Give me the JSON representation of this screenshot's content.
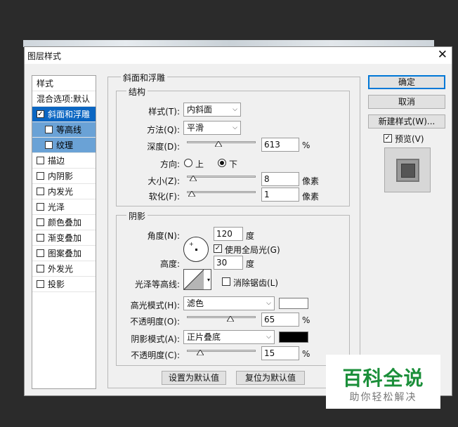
{
  "dialog": {
    "title": "图层样式",
    "close_icon": "close-icon"
  },
  "left_list": {
    "items": [
      {
        "label": "样式",
        "checkbox": false,
        "checked": false
      },
      {
        "label": "混合选项:默认",
        "checkbox": false,
        "checked": false
      },
      {
        "label": "斜面和浮雕",
        "checkbox": true,
        "checked": true,
        "selected": true
      },
      {
        "label": "等高线",
        "checkbox": true,
        "checked": false,
        "sub": true
      },
      {
        "label": "纹理",
        "checkbox": true,
        "checked": false,
        "sub": true
      },
      {
        "label": "描边",
        "checkbox": true,
        "checked": false
      },
      {
        "label": "内阴影",
        "checkbox": true,
        "checked": false
      },
      {
        "label": "内发光",
        "checkbox": true,
        "checked": false
      },
      {
        "label": "光泽",
        "checkbox": true,
        "checked": false
      },
      {
        "label": "颜色叠加",
        "checkbox": true,
        "checked": false
      },
      {
        "label": "渐变叠加",
        "checkbox": true,
        "checked": false
      },
      {
        "label": "图案叠加",
        "checkbox": true,
        "checked": false
      },
      {
        "label": "外发光",
        "checkbox": true,
        "checked": false
      },
      {
        "label": "投影",
        "checkbox": true,
        "checked": false
      }
    ]
  },
  "bevel": {
    "group_title": "斜面和浮雕",
    "structure_title": "结构",
    "style_label": "样式(T):",
    "style_value": "内斜面",
    "technique_label": "方法(Q):",
    "technique_value": "平滑",
    "depth_label": "深度(D):",
    "depth_value": "613",
    "depth_unit": "%",
    "depth_level": 0.45,
    "direction_label": "方向:",
    "direction_up": "上",
    "direction_down": "下",
    "direction_selected": "down",
    "size_label": "大小(Z):",
    "size_value": "8",
    "size_unit": "像素",
    "size_level": 0.03,
    "soften_label": "软化(F):",
    "soften_value": "1",
    "soften_unit": "像素",
    "soften_level": 0.01
  },
  "shading": {
    "group_title": "阴影",
    "angle_label": "角度(N):",
    "angle_value": "120",
    "angle_unit": "度",
    "global_light_label": "使用全局光(G)",
    "global_light_checked": true,
    "altitude_label": "高度:",
    "altitude_value": "30",
    "altitude_unit": "度",
    "gloss_label": "光泽等高线:",
    "antialias_label": "消除锯齿(L)",
    "antialias_checked": false,
    "highlight_mode_label": "高光模式(H):",
    "highlight_mode_value": "滤色",
    "highlight_color": "#ffffff",
    "highlight_opacity_label": "不透明度(O):",
    "highlight_opacity_value": "65",
    "highlight_opacity_unit": "%",
    "highlight_opacity_level": 0.65,
    "shadow_mode_label": "阴影模式(A):",
    "shadow_mode_value": "正片叠底",
    "shadow_color": "#000000",
    "shadow_opacity_label": "不透明度(C):",
    "shadow_opacity_value": "15",
    "shadow_opacity_unit": "%",
    "shadow_opacity_level": 0.15
  },
  "buttons": {
    "make_default": "设置为默认值",
    "reset_default": "复位为默认值",
    "ok": "确定",
    "cancel": "取消",
    "new_style": "新建样式(W)...",
    "preview_label": "预览(V)",
    "preview_checked": true
  },
  "watermark": {
    "line1": "百科全说",
    "line2": "助你轻松解决"
  }
}
